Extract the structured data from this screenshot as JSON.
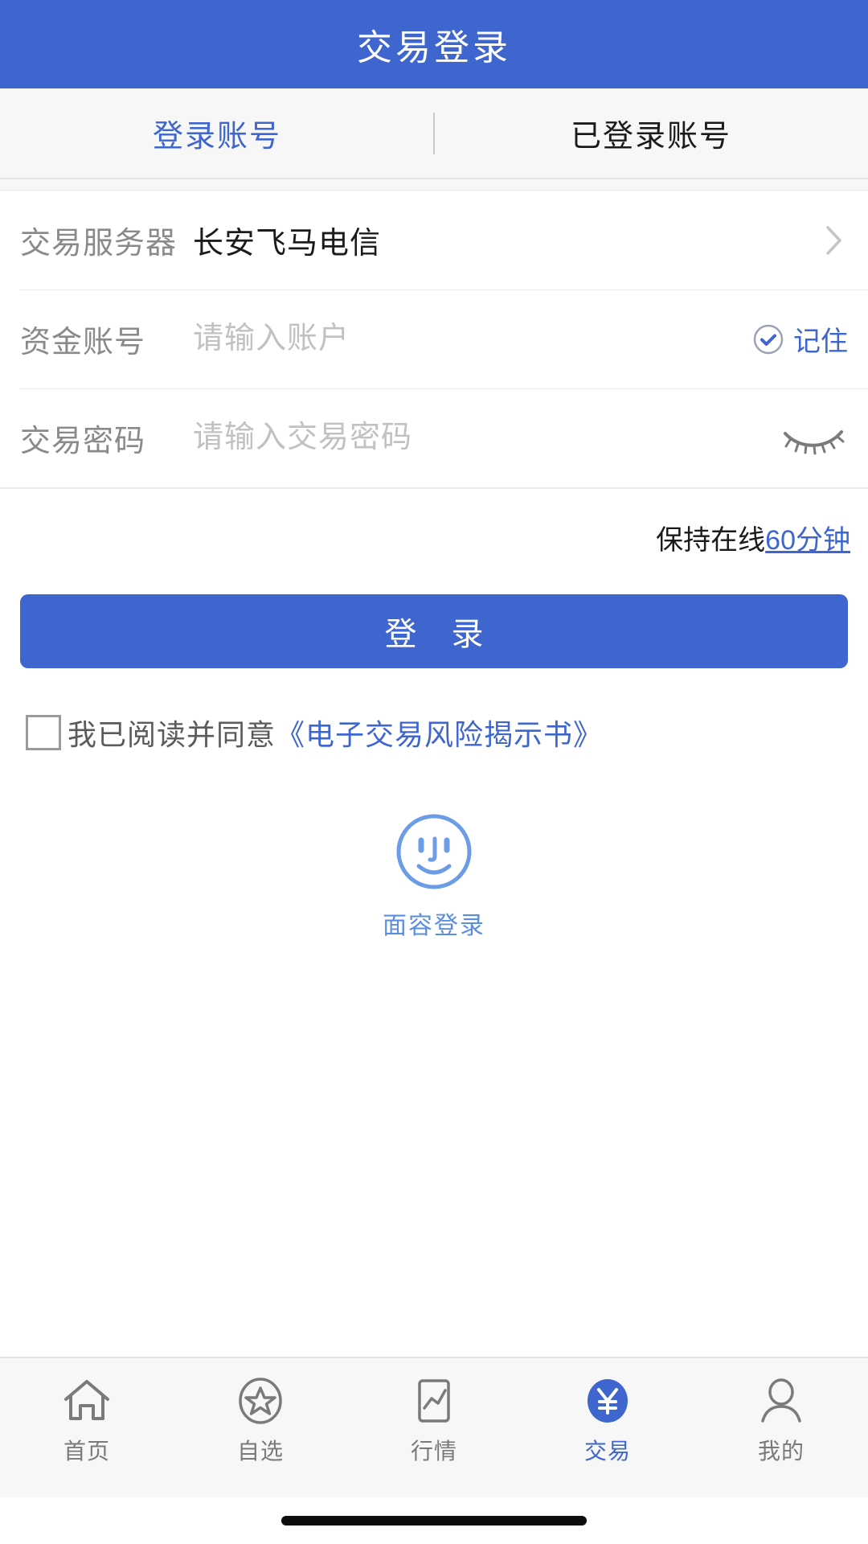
{
  "header": {
    "title": "交易登录"
  },
  "segment": {
    "tabs": [
      {
        "label": "登录账号",
        "active": true
      },
      {
        "label": "已登录账号",
        "active": false
      }
    ]
  },
  "form": {
    "server_row": {
      "label": "交易服务器",
      "value": "长安飞马电信",
      "chevron": "chevron-right-icon"
    },
    "account_row": {
      "label": "资金账号",
      "value": "",
      "placeholder": "请输入账户",
      "remember_label": "记住",
      "remember_icon": "circle-check-icon",
      "remember_checked": true
    },
    "password_row": {
      "label": "交易密码",
      "value": "",
      "placeholder": "请输入交易密码",
      "visibility_icon": "eye-closed-icon"
    }
  },
  "keep_online": {
    "prefix": "保持在线",
    "duration": "60分钟"
  },
  "login_button": {
    "label": "登 录"
  },
  "agreement": {
    "checked": false,
    "text": "我已阅读并同意",
    "link": "《电子交易风险揭示书》"
  },
  "face_login": {
    "icon": "smiling-face-icon",
    "label": "面容登录"
  },
  "tabbar": {
    "items": [
      {
        "label": "首页",
        "icon": "home-icon",
        "active": false
      },
      {
        "label": "自选",
        "icon": "star-circle-icon",
        "active": false
      },
      {
        "label": "行情",
        "icon": "chart-icon",
        "active": false
      },
      {
        "label": "交易",
        "icon": "yuan-circle-icon",
        "active": true
      },
      {
        "label": "我的",
        "icon": "person-icon",
        "active": false
      }
    ]
  },
  "colors": {
    "brand_blue": "#3e66ce",
    "link_blue": "#3e66ce",
    "face_blue": "#5b8ede",
    "label_gray": "#8a8a8a",
    "placeholder_gray": "#c1c1c1",
    "bar_bg": "#f7f7f7"
  }
}
